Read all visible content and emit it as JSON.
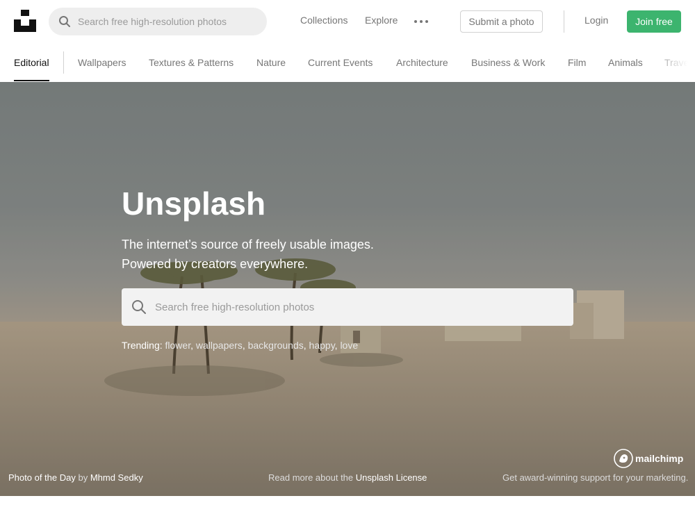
{
  "header": {
    "search_placeholder": "Search free high-resolution photos",
    "nav": [
      "Collections",
      "Explore"
    ],
    "submit_label": "Submit a photo",
    "login_label": "Login",
    "join_label": "Join free"
  },
  "categories": {
    "active": "Editorial",
    "items": [
      "Wallpapers",
      "Textures & Patterns",
      "Nature",
      "Current Events",
      "Architecture",
      "Business & Work",
      "Film",
      "Animals",
      "Travel"
    ]
  },
  "hero": {
    "title": "Unsplash",
    "subtitle_line1": "The internet’s source of freely usable images.",
    "subtitle_line2": "Powered by creators everywhere.",
    "search_placeholder": "Search free high-resolution photos",
    "trending_label": "Trending:",
    "trending": [
      "flower",
      "wallpapers",
      "backgrounds",
      "happy",
      "love"
    ]
  },
  "footer": {
    "photo_of_day": "Photo of the Day",
    "by": "by",
    "photographer": "Mhmd Sedky",
    "license_text": "Read more about the",
    "license_link": "Unsplash License",
    "sponsor_name": "mailchimp",
    "sponsor_text": "Get award-winning support for your marketing."
  },
  "colors": {
    "accent": "#3cb46e",
    "text_muted": "#767676"
  },
  "icons": [
    "unsplash-logo",
    "search-icon",
    "more-icon",
    "mailchimp-icon"
  ]
}
